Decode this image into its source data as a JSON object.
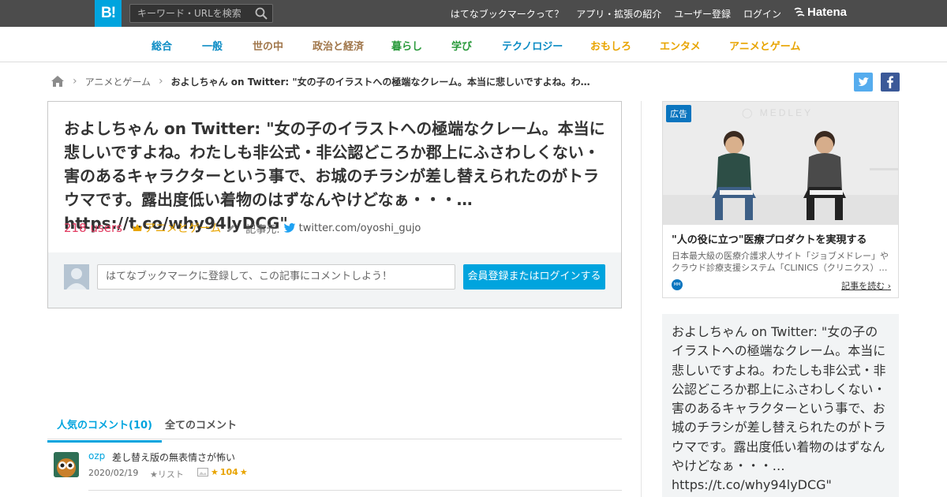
{
  "header": {
    "logo": "B!",
    "search_placeholder": "キーワード・URLを検索",
    "links": [
      "はてなブックマークって？",
      "アプリ・拡張の紹介",
      "ユーザー登録",
      "ログイン"
    ],
    "brand": "Hatena"
  },
  "categories": [
    {
      "label": "総合",
      "color": "#0a8bc4"
    },
    {
      "label": "一般",
      "color": "#0a8bc4"
    },
    {
      "label": "世の中",
      "color": "#a0764a"
    },
    {
      "label": "政治と経済",
      "color": "#a0764a"
    },
    {
      "label": "暮らし",
      "color": "#2a9a3c"
    },
    {
      "label": "学び",
      "color": "#2a9a3c"
    },
    {
      "label": "テクノロジー",
      "color": "#0a8bc4"
    },
    {
      "label": "おもしろ",
      "color": "#e8a400"
    },
    {
      "label": "エンタメ",
      "color": "#e8a400"
    },
    {
      "label": "アニメとゲーム",
      "color": "#e8a400"
    }
  ],
  "breadcrumb": {
    "category": "アニメとゲーム",
    "current": "およしちゃん on Twitter: \"女の子のイラストへの極端なクレーム。本当に悲しいですよね。わたし…"
  },
  "entry": {
    "title": "およしちゃん on Twitter: \"女の子のイラストへの極端なクレーム。本当に悲しいですよね。わたしも非公式・非公認どころか郡上にふさわしくない・害のあるキャラクターという事で、お城のチラシが差し替えられたのがトラウマです。露出度低い着物のはずなんやけどなぁ・・・… https://t.co/why94lyDCG\"",
    "users": "218 users",
    "category": "アニメとゲーム",
    "source_label": "記事元:",
    "source": "twitter.com/oyoshi_gujo",
    "comment_placeholder": "はてなブックマークに登録して、この記事にコメントしよう！",
    "login_button": "会員登録またはログインする"
  },
  "tabs": [
    "人気のコメント(10)",
    "全てのコメント"
  ],
  "comments": [
    {
      "user": "ozp",
      "text": "差し替え版の無表情さが怖い",
      "date": "2020/02/19",
      "list": "★リスト",
      "stars": "104"
    }
  ],
  "ad": {
    "badge": "広告",
    "title": "\"人の役に立つ\"医療プロダクトを実現する",
    "description": "日本最大級の医療介護求人サイト「ジョブメドレー」やクラウド診療支援システム「CLINICS（クリニクス）…",
    "link": "記事を読む",
    "logo": "MM"
  },
  "summary": "およしちゃん on Twitter: \"女の子のイラストへの極端なクレーム。本当に悲しいですよね。わたしも非公式・非公認どころか郡上にふさわしくない・害のあるキャラクターという事で、お城のチラシが差し替えられたのがトラウマです。露出度低い着物のはずなんやけどなぁ・・・… https://t.co/why94lyDCG\""
}
